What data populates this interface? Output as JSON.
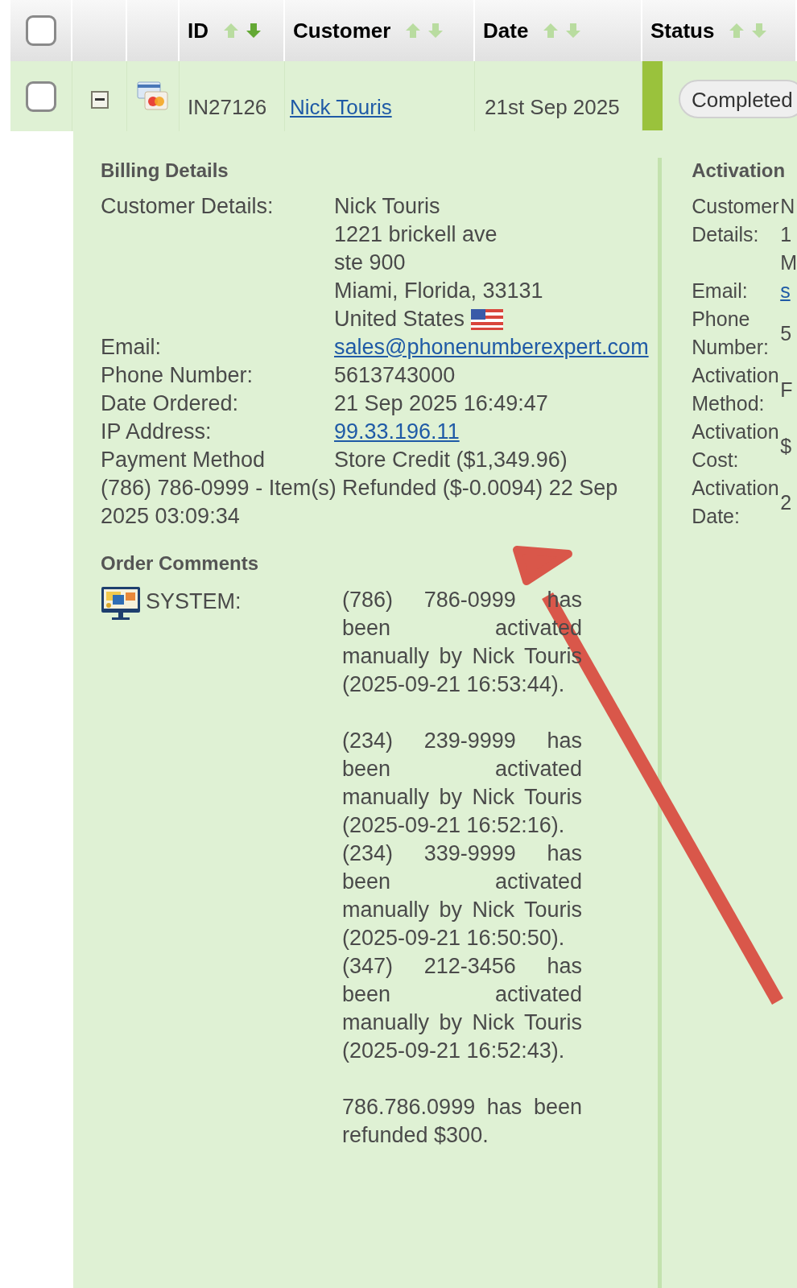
{
  "table": {
    "select_all": {
      "checked": false
    },
    "columns": [
      {
        "label": "ID",
        "sorted_descending": true
      },
      {
        "label": "Customer",
        "sorted_descending": false
      },
      {
        "label": "Date",
        "sorted_descending": false
      },
      {
        "label": "Status",
        "sorted_descending": false
      }
    ],
    "rows": [
      {
        "checked": false,
        "expanded": true,
        "id": "IN27126",
        "customer": "Nick Touris",
        "date": "21st Sep 2025",
        "status": "Completed",
        "color": "#9ac23c"
      }
    ]
  },
  "billing": {
    "title": "Billing Details",
    "rows": [
      {
        "kind": "address",
        "label": "Customer Details:",
        "lines": [
          "Nick Touris",
          "1221 brickell ave",
          "ste 900",
          "Miami, Florida, 33131",
          "United States"
        ]
      },
      {
        "kind": "link",
        "label": "Email:",
        "value": "sales@phonenumberexpert.com"
      },
      {
        "kind": "text",
        "label": "Phone Number:",
        "value": "5613743000"
      },
      {
        "kind": "text",
        "label": "Date Ordered:",
        "value": "21 Sep 2025 16:49:47"
      },
      {
        "kind": "link",
        "label": "IP Address:",
        "value": "99.33.196.11"
      },
      {
        "kind": "text",
        "label": "Payment Method",
        "value": "Store Credit ($1,349.96)"
      }
    ],
    "note": "(786) 786-0999 - Item(s) Refunded ($-0.0094) 22 Sep 2025 03:09:34"
  },
  "comments": {
    "title": "Order Comments",
    "entries": [
      {
        "author": "SYSTEM:",
        "paragraphs": [
          [
            [
              "(786) 786-0999 has",
              "been activated",
              "manually by Nick Touris",
              "(2025-09-21 16:53:44)."
            ]
          ],
          [
            [
              "(234) 239-9999 has",
              "been activated",
              "manually by Nick Touris",
              "(2025-09-21 16:52:16)."
            ],
            [
              "(234) 339-9999 has",
              "been activated",
              "manually by Nick Touris",
              "(2025-09-21 16:50:50)."
            ],
            [
              "(347) 212-3456 has",
              "been activated",
              "manually by Nick Touris",
              "(2025-09-21 16:52:43)."
            ]
          ],
          [
            [
              "786.786.0999 has been",
              "refunded $300."
            ]
          ]
        ]
      }
    ]
  },
  "activation": {
    "title": "Activation",
    "rows": [
      {
        "kind": "lines",
        "label": "Customer Details:",
        "lines": [
          "N",
          "1",
          "M"
        ]
      },
      {
        "kind": "link",
        "label": "Email:",
        "value": "s"
      },
      {
        "kind": "text",
        "label": "Phone Number:",
        "value": "5"
      },
      {
        "kind": "text",
        "label": "Activation Method:",
        "value": "F"
      },
      {
        "kind": "text",
        "label": "Activation Cost:",
        "value": "$"
      },
      {
        "kind": "text",
        "label": "Activation Date:",
        "value": "2"
      }
    ]
  }
}
